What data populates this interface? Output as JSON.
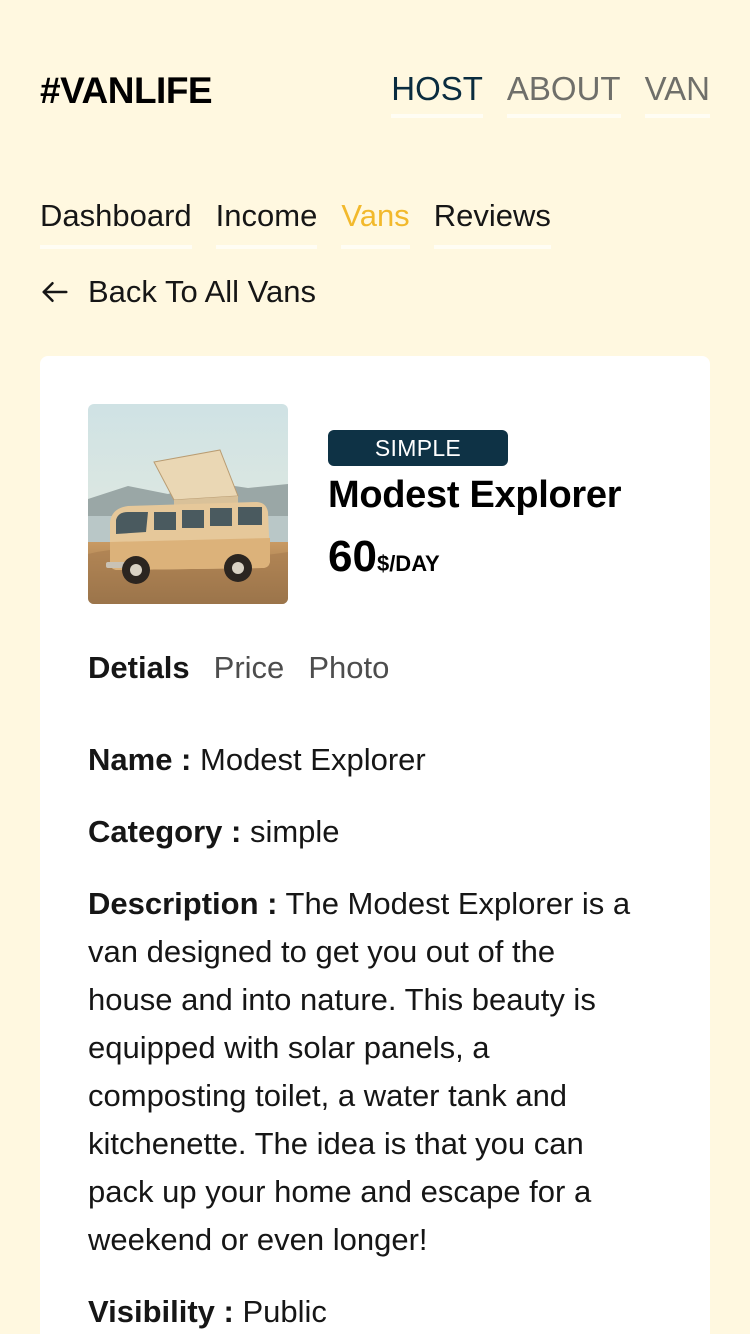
{
  "header": {
    "logo": "#VANLIFE",
    "nav": [
      {
        "label": "HOST",
        "active": true
      },
      {
        "label": "ABOUT",
        "active": false
      },
      {
        "label": "VAN",
        "active": false
      }
    ]
  },
  "host_nav": [
    {
      "label": "Dashboard",
      "active": false
    },
    {
      "label": "Income",
      "active": false
    },
    {
      "label": "Vans",
      "active": true
    },
    {
      "label": "Reviews",
      "active": false
    }
  ],
  "back_link": {
    "label": "Back To All Vans",
    "icon": "arrow-left-icon"
  },
  "van": {
    "type": "SIMPLE",
    "name": "Modest Explorer",
    "price": "60",
    "price_unit": "$/DAY"
  },
  "detail_tabs": [
    {
      "label": "Detials",
      "active": true
    },
    {
      "label": "Price",
      "active": false
    },
    {
      "label": "Photo",
      "active": false
    }
  ],
  "details": {
    "name_label": "Name :",
    "name_value": "Modest Explorer",
    "category_label": "Category :",
    "category_value": "simple",
    "description_label": "Description :",
    "description_value": "The Modest Explorer is a van designed to get you out of the house and into nature. This beauty is equipped with solar panels, a composting toilet, a water tank and kitchenette. The idea is that you can pack up your home and escape for a weekend or even longer!",
    "visibility_label": "Visibility :",
    "visibility_value": "Public"
  },
  "colors": {
    "page_bg": "#FFF8E0",
    "accent": "#F2B92C",
    "badge_bg": "#0E3245",
    "nav_active": "#0A2C3F"
  }
}
